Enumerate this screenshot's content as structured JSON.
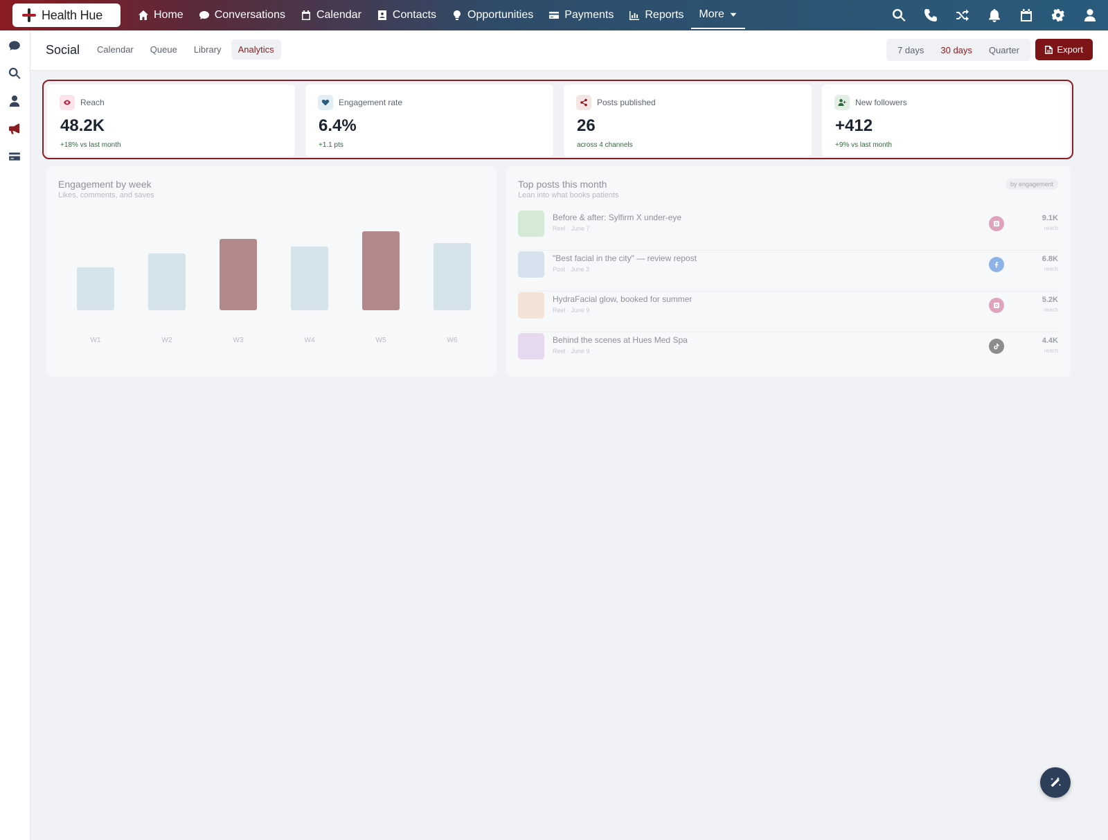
{
  "brand": {
    "name": "Health Hue"
  },
  "nav": {
    "items": [
      {
        "label": "Home",
        "icon": "home-icon"
      },
      {
        "label": "Conversations",
        "icon": "chat-bubble-icon"
      },
      {
        "label": "Calendar",
        "icon": "calendar-icon"
      },
      {
        "label": "Contacts",
        "icon": "contact-card-icon"
      },
      {
        "label": "Opportunities",
        "icon": "lightbulb-icon"
      },
      {
        "label": "Payments",
        "icon": "credit-card-icon"
      },
      {
        "label": "Reports",
        "icon": "bar-chart-icon"
      },
      {
        "label": "More",
        "icon": "caret-down-icon"
      }
    ],
    "right_icons": [
      "search-icon",
      "phone-icon",
      "shuffle-icon",
      "bell-icon",
      "calendar-icon",
      "gear-icon",
      "user-icon"
    ]
  },
  "sidebar": {
    "icons": [
      "chat-bubble-icon",
      "search-icon",
      "user-icon",
      "megaphone-icon",
      "credit-card-icon"
    ],
    "active": "megaphone-icon"
  },
  "subheader": {
    "title": "Social",
    "tabs": [
      "Calendar",
      "Queue",
      "Library",
      "Analytics"
    ],
    "active_tab": "Analytics",
    "ranges": [
      "7 days",
      "30 days",
      "Quarter"
    ],
    "active_range": "30 days",
    "export_label": "Export"
  },
  "stats": [
    {
      "label": "Reach",
      "value": "48.2K",
      "sub": "+18% vs last month",
      "icon": "eye-icon",
      "icon_bg": "#fbe3ea",
      "icon_color": "#b0234a"
    },
    {
      "label": "Engagement rate",
      "value": "6.4%",
      "sub": "+1.1 pts",
      "icon": "heart-icon",
      "icon_bg": "#e1eef6",
      "icon_color": "#2a5b7c"
    },
    {
      "label": "Posts published",
      "value": "26",
      "sub": "across 4 channels",
      "icon": "share-icon",
      "icon_bg": "#f5e4e4",
      "icon_color": "#8a1c22"
    },
    {
      "label": "New followers",
      "value": "+412",
      "sub": "+9% vs last month",
      "icon": "user-plus-icon",
      "icon_bg": "#e3efe4",
      "icon_color": "#2f6a3a"
    }
  ],
  "engagement": {
    "title": "Engagement by week",
    "subtitle": "Likes, comments, and saves"
  },
  "chart_data": {
    "type": "bar",
    "categories": [
      "W1",
      "W2",
      "W3",
      "W4",
      "W5",
      "W6"
    ],
    "values": [
      62,
      82,
      103,
      92,
      114,
      97
    ],
    "highlighted": [
      "W3",
      "W5"
    ],
    "colors": {
      "default": "#d5e3ea",
      "highlight": "#b3888a"
    },
    "grid": false
  },
  "top_posts": {
    "title": "Top posts this month",
    "subtitle": "Lean into what books patients",
    "badge": "by engagement",
    "items": [
      {
        "title": "Before & after: Sylfirm X under-eye",
        "meta": "Reel · June 7",
        "value": "9.1K",
        "unit": "reach",
        "thumb_color": "#d4ead7",
        "channel": "instagram-icon",
        "channel_color": "#e0a3bd"
      },
      {
        "title": "\"Best facial in the city\" — review repost",
        "meta": "Post · June 3",
        "value": "6.8K",
        "unit": "reach",
        "thumb_color": "#d5e2ee",
        "channel": "facebook-icon",
        "channel_color": "#8db3e8"
      },
      {
        "title": "HydraFacial glow, booked for summer",
        "meta": "Reel · June 9",
        "value": "5.2K",
        "unit": "reach",
        "thumb_color": "#f3e2d6",
        "channel": "instagram-icon",
        "channel_color": "#e0a3bd"
      },
      {
        "title": "Behind the scenes at Hues Med Spa",
        "meta": "Reel · June 9",
        "value": "4.4K",
        "unit": "reach",
        "thumb_color": "#e6d9ef",
        "channel": "tiktok-icon",
        "channel_color": "#8c8c8c"
      }
    ]
  },
  "fab": {
    "icon": "magic-wand-icon"
  }
}
